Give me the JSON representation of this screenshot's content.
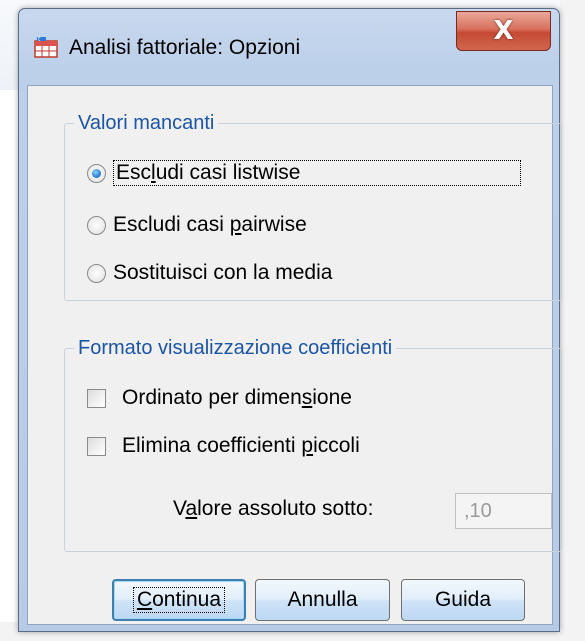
{
  "window": {
    "title": "Analisi fattoriale: Opzioni",
    "close_symbol": "X",
    "app_icon": "spss-table-icon"
  },
  "missing_values": {
    "legend": "Valori mancanti",
    "options": [
      {
        "label_pre": "Esc",
        "label_key": "l",
        "label_post": "udi casi listwise",
        "checked": true
      },
      {
        "label_pre": "Escludi casi ",
        "label_key": "p",
        "label_post": "airwise",
        "checked": false
      },
      {
        "label_pre": "Sostituisci con la media",
        "label_key": "",
        "label_post": "",
        "checked": false
      }
    ]
  },
  "coefficient_format": {
    "legend": "Formato visualizzazione coefficienti",
    "sorted": {
      "label_pre": "Ordinato per dimen",
      "label_key": "s",
      "label_post": "ione",
      "checked": false
    },
    "suppress": {
      "label_pre": "Elimina coefficienti ",
      "label_key": "p",
      "label_post": "iccoli",
      "checked": false
    },
    "abs_value_label_pre": "V",
    "abs_value_label_key": "a",
    "abs_value_label_post": "lore assoluto sotto:",
    "abs_value": ",10"
  },
  "buttons": {
    "continue_key": "C",
    "continue_rest": "ontinua",
    "cancel": "Annulla",
    "help": "Guida"
  },
  "colors": {
    "legend_text": "#1c54a6",
    "close_button": "#c44a33",
    "client_bg": "#f0f0f0"
  }
}
